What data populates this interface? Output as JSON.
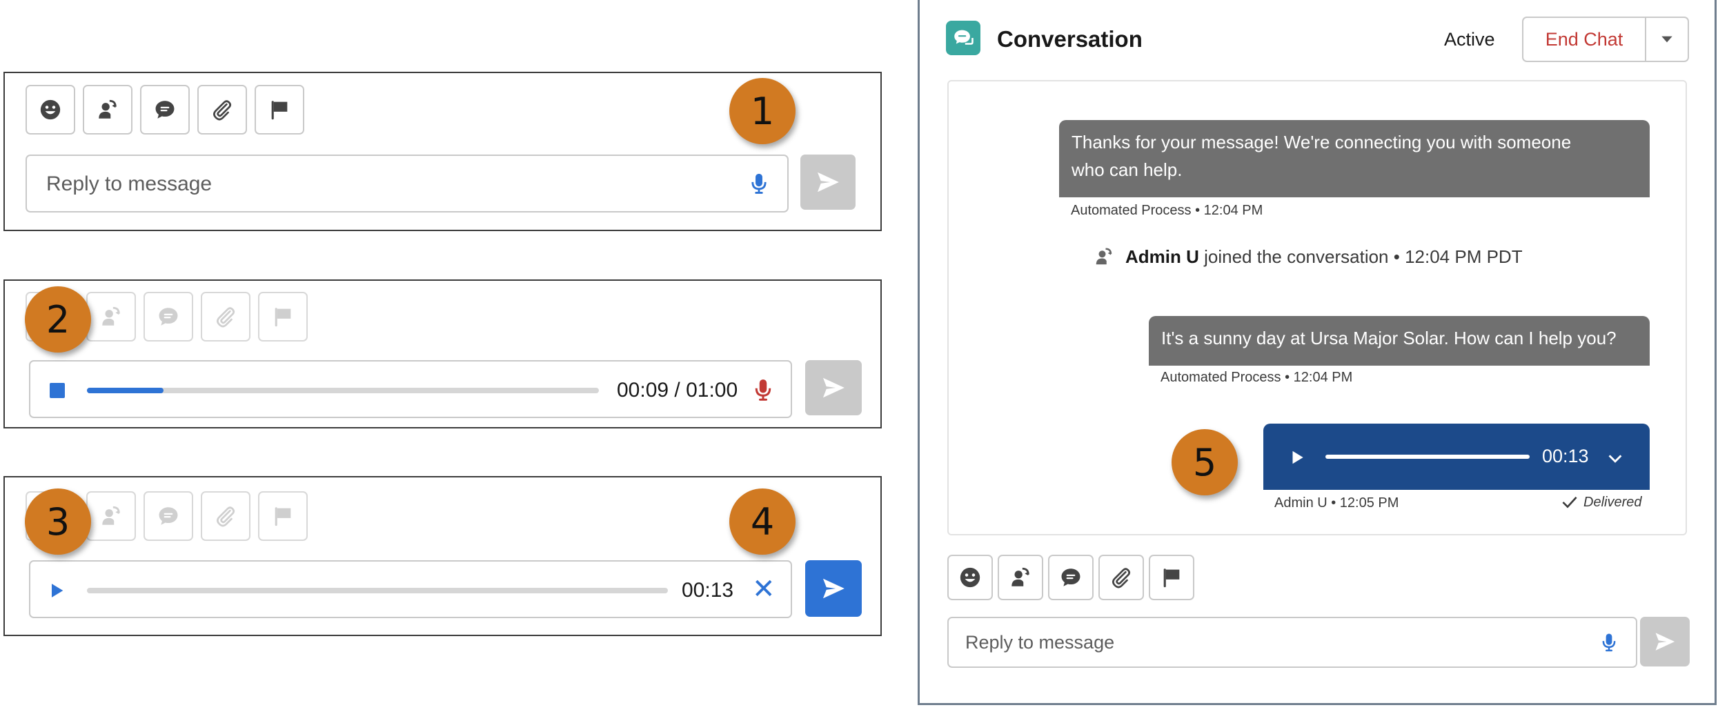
{
  "panel1": {
    "placeholder": "Reply to message",
    "callout": "1"
  },
  "panel2": {
    "time": "00:09 / 01:00",
    "progress": 0.15,
    "callout": "2"
  },
  "panel3": {
    "time": "00:13",
    "callout_left": "3",
    "callout_right": "4"
  },
  "conversation": {
    "title": "Conversation",
    "status": "Active",
    "end_chat_label": "End Chat",
    "messages": [
      {
        "text_line1": "Thanks for your message! We're connecting you with someone",
        "text_line2": "who can help.",
        "meta": "Automated Process • 12:04 PM"
      },
      {
        "text": "It's a sunny day at Ursa Major Solar. How can I help you?",
        "meta": "Automated Process • 12:04 PM"
      }
    ],
    "join_event": {
      "name": "Admin U",
      "text": " joined the conversation • 12:04 PM PDT"
    },
    "voice_message": {
      "duration": "00:13",
      "meta": "Admin U • 12:05 PM",
      "status": "Delivered"
    },
    "callout": "5",
    "reply_placeholder": "Reply to message"
  },
  "colors": {
    "accent": "#2e73d5",
    "callout": "#d17a22",
    "voice_bubble": "#1c4a8a",
    "end_chat": "#c23934",
    "teal_icon": "#3aa8a0"
  }
}
